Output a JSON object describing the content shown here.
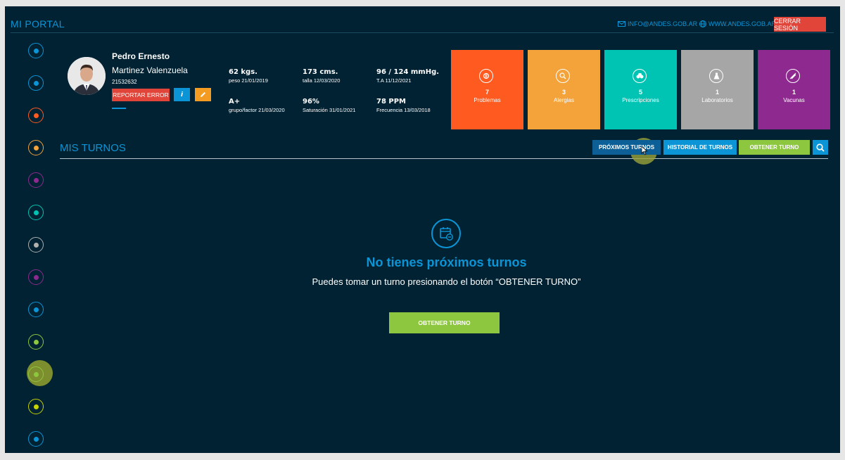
{
  "header": {
    "title": "MI PORTAL",
    "email": "INFO@ANDES.GOB.AR",
    "website": "WWW.ANDES.GOB.AR",
    "logout": "CERRAR SESIÓN"
  },
  "sidebar": {
    "items": [
      {
        "name": "dashboard",
        "color": "#0b95d6"
      },
      {
        "name": "profile",
        "color": "#0b95d6"
      },
      {
        "name": "problems",
        "color": "#ff5a1f"
      },
      {
        "name": "allergies",
        "color": "#f4a23a"
      },
      {
        "name": "vitals",
        "color": "#8e2a8f"
      },
      {
        "name": "prescriptions",
        "color": "#00c4b3"
      },
      {
        "name": "laboratories",
        "color": "#b0b0b0"
      },
      {
        "name": "vaccines",
        "color": "#8e2a8f"
      },
      {
        "name": "family",
        "color": "#0b95d6"
      },
      {
        "name": "documents",
        "color": "#8dc63f"
      },
      {
        "name": "appointments",
        "color": "#8dc63f"
      },
      {
        "name": "messages",
        "color": "#c8d400"
      },
      {
        "name": "institutions",
        "color": "#0b95d6"
      }
    ]
  },
  "patient": {
    "first_name": "Pedro Ernesto",
    "last_name": "Martinez Valenzuela",
    "dni": "21532632",
    "report_error": "REPORTAR ERROR",
    "info": "i",
    "vitals": [
      {
        "value": "62 kgs.",
        "detail": "peso 21/01/2019"
      },
      {
        "value": "173 cms.",
        "detail": "talla 12/03/2020"
      },
      {
        "value": "96 / 124 mmHg.",
        "detail": "T.A 11/12/2021"
      },
      {
        "value": "A+",
        "detail": "grupo/factor 21/03/2020"
      },
      {
        "value": "96%",
        "detail": "Saturación 31/01/2021"
      },
      {
        "value": "78 PPM",
        "detail": "Frecuencia 13/03/2018"
      }
    ]
  },
  "cards": [
    {
      "count": "7",
      "label": "Problemas",
      "color": "#ff5a1f",
      "icon": "brain-icon"
    },
    {
      "count": "3",
      "label": "Alergias",
      "color": "#f4a23a",
      "icon": "magnifier-icon"
    },
    {
      "count": "5",
      "label": "Prescripciones",
      "color": "#00c4b3",
      "icon": "pills-icon"
    },
    {
      "count": "1",
      "label": "Laboratorios",
      "color": "#a6a6a6",
      "icon": "flask-icon"
    },
    {
      "count": "1",
      "label": "Vacunas",
      "color": "#8e2a8f",
      "icon": "syringe-icon"
    }
  ],
  "turnos": {
    "title": "MIS TURNOS",
    "tabs": {
      "upcoming": "PRÓXIMOS TURNOS",
      "history": "HISTORIAL DE TURNOS",
      "get": "OBTENER TURNO"
    },
    "empty_title": "No tienes próximos turnos",
    "empty_sub": "Puedes tomar un turno presionando el botón “OBTENER TURNO”",
    "empty_button": "OBTENER TURNO"
  }
}
